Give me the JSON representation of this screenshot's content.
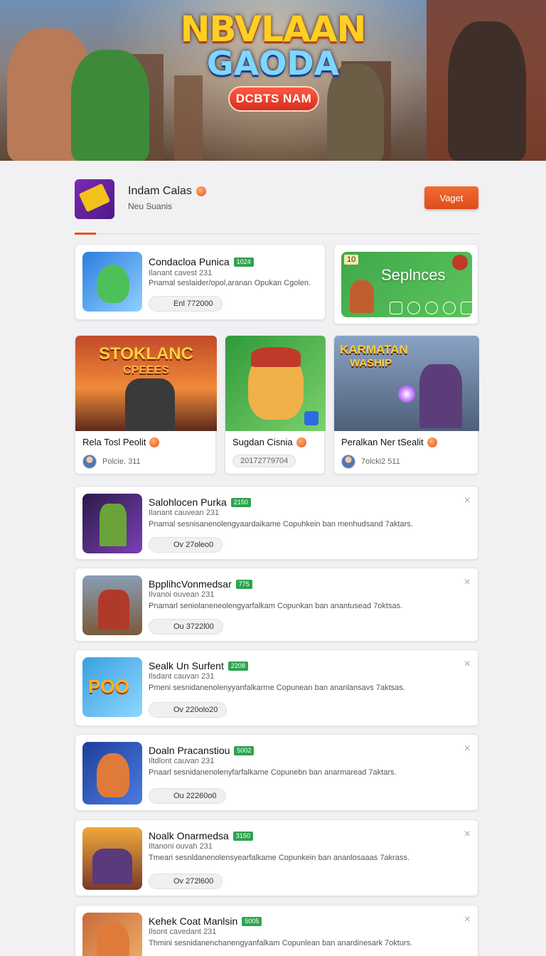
{
  "hero": {
    "title_line1": "NBVLAAN",
    "title_line2": "GAODA",
    "cta_label": "DCBTS NAM"
  },
  "profile": {
    "name": "Indam Calas",
    "subtitle": "Neu Suanis",
    "action_label": "Vaget"
  },
  "featured": {
    "title": "Condacloa Punica",
    "badge": "1024",
    "meta": "Ilanant cavest 231",
    "desc": "Pnamal seslaider/opol,aranan Opukan Cgolen.",
    "pill": "Enl 772000"
  },
  "promo": {
    "label": "Seplnces",
    "corner": "10"
  },
  "grid": [
    {
      "title": "Rela Tosl Peolit",
      "meta": "Polcie. 311",
      "art_top": "STOKLANC",
      "art_bottom": "CPEEES"
    },
    {
      "title": "Sugdan Cisnia",
      "meta": "20172779704",
      "art_top": "",
      "art_bottom": ""
    },
    {
      "title": "Peralkan Ner tSealit",
      "meta": "7olcki2 511",
      "art_top": "KARMATAN",
      "art_bottom": "WASHIP"
    }
  ],
  "list": [
    {
      "title": "Salohlocen Purka",
      "badge": "2150",
      "meta": "Ilanant cauvean 231",
      "desc": "Pnamal sesnisanenolengyaardaikame Copuhkein ban menhudsand 7aktars.",
      "pill": "Ov 27oleo0"
    },
    {
      "title": "BpplihcVonmedsar",
      "badge": "775",
      "meta": "Ilvanoi ouvean 231",
      "desc": "Pnamarl seniolaneneolengyarfalkam Copunkan ban anantusead 7oktsas.",
      "pill": "Ou 3722l00"
    },
    {
      "title": "Sealk Un Surfent",
      "badge": "2208",
      "meta": "Ilsdant cauvan 231",
      "desc": "Pmeni sesnidanenolenyyanfalkarme Copunean ban ananlansavs 7aktsas.",
      "pill": "Ov 220olo20"
    },
    {
      "title": "Doaln Pracanstiou",
      "badge": "5002",
      "meta": "Iltdlont cauvan 231",
      "desc": "Pnaarl sesnidanenolenyfarfalkame Copunebn ban anarmaread 7aktars.",
      "pill": "Ou 22260o0"
    },
    {
      "title": "Noalk Onarmedsa",
      "badge": "3150",
      "meta": "Iltanoni ouvah 231",
      "desc": "Tmeari sesnldanenolensyearfalkame Copunkein ban ananlosaaas 7akrass.",
      "pill": "Ov 272l600"
    },
    {
      "title": "Kehek Coat Manlsin",
      "badge": "5005",
      "meta": "Ilsont cavedant 231",
      "desc": "Thmini sesnidanenchanengyanfalkam Copunlean ban anardinesark 7okturs.",
      "pill": ""
    }
  ],
  "icons": {
    "close": "×",
    "coin": "coin-icon"
  },
  "colors": {
    "accent": "#e2531f",
    "badge": "#2ea44f"
  }
}
